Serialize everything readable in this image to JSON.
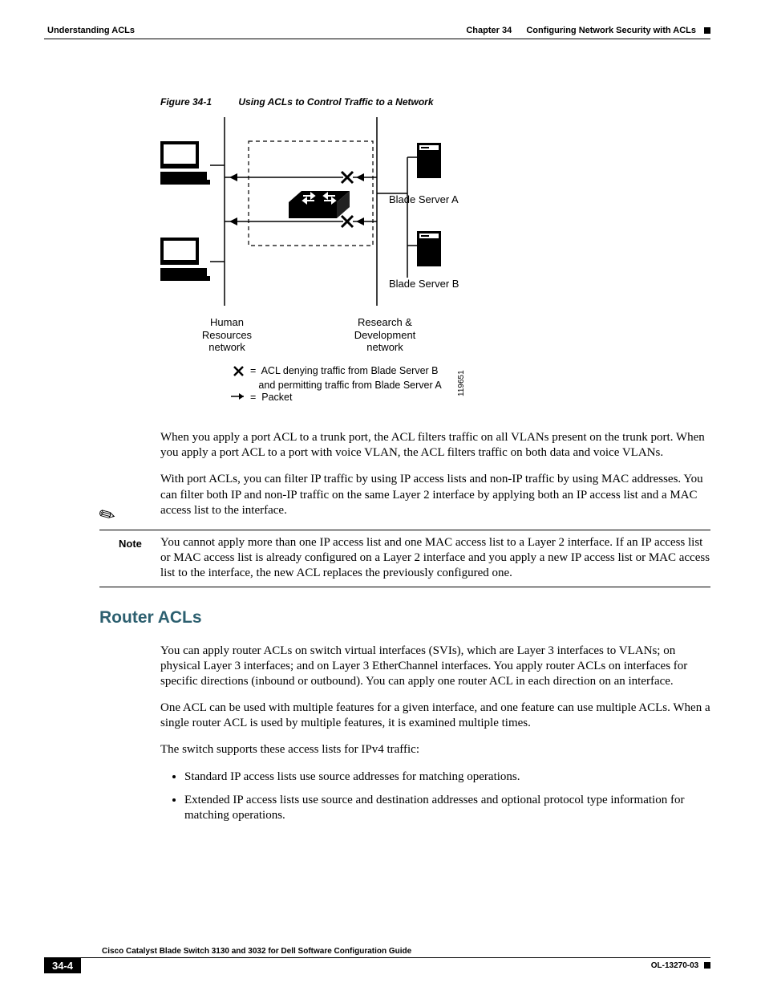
{
  "header": {
    "left": "Understanding ACLs",
    "chapter_label": "Chapter 34",
    "chapter_title": "Configuring Network Security with ACLs"
  },
  "figure": {
    "number": "Figure 34-1",
    "title": "Using ACLs to Control Traffic to a Network",
    "labels": {
      "blade_a": "Blade Server A",
      "blade_b": "Blade Server B",
      "left_net_l1": "Human",
      "left_net_l2": "Resources",
      "left_net_l3": "network",
      "right_net_l1": "Research &",
      "right_net_l2": "Development",
      "right_net_l3": "network",
      "legend_deny_sym": "✕",
      "legend_deny_eq": "=",
      "legend_deny_l1a": "ACL denying traffic from ",
      "legend_deny_l1b": "Blade Server B",
      "legend_deny_l2a": "and permitting traffic from ",
      "legend_deny_l2b": "Blade Server A",
      "legend_pkt_sym": "→",
      "legend_pkt_eq": "=",
      "legend_pkt": "Packet",
      "sideid": "119651"
    }
  },
  "paragraphs": {
    "p1": "When you apply a port ACL to a trunk port, the ACL filters traffic on all VLANs present on the trunk port. When you apply a port ACL to a port with voice VLAN, the ACL filters traffic on both data and voice VLANs.",
    "p2": "With port ACLs, you can filter IP traffic by using IP access lists and non-IP traffic by using MAC addresses. You can filter both IP and non-IP traffic on the same Layer 2 interface by applying both an IP access list and a MAC access list to the interface."
  },
  "note": {
    "label": "Note",
    "text": "You cannot apply more than one IP access list and one MAC access list to a Layer 2 interface. If an IP access list or MAC access list is already configured on a Layer 2 interface and you apply a new IP access list or MAC access list to the interface, the new ACL replaces the previously configured one."
  },
  "section2": {
    "heading": "Router ACLs",
    "p1": "You can apply router ACLs on switch virtual interfaces (SVIs), which are Layer 3 interfaces to VLANs; on physical Layer 3 interfaces; and on Layer 3 EtherChannel interfaces. You apply router ACLs on interfaces for specific directions (inbound or outbound). You can apply one router ACL in each direction on an interface.",
    "p2": "One ACL can be used with multiple features for a given interface, and one feature can use multiple ACLs. When a single router ACL is used by multiple features, it is examined multiple times.",
    "p3": "The switch supports these access lists for IPv4 traffic:",
    "bullets": [
      "Standard IP access lists use source addresses for matching operations.",
      "Extended IP access lists use source and destination addresses and optional protocol type information for matching operations."
    ]
  },
  "footer": {
    "title": "Cisco Catalyst Blade Switch 3130 and 3032 for Dell Software Configuration Guide",
    "page": "34-4",
    "docid": "OL-13270-03"
  }
}
